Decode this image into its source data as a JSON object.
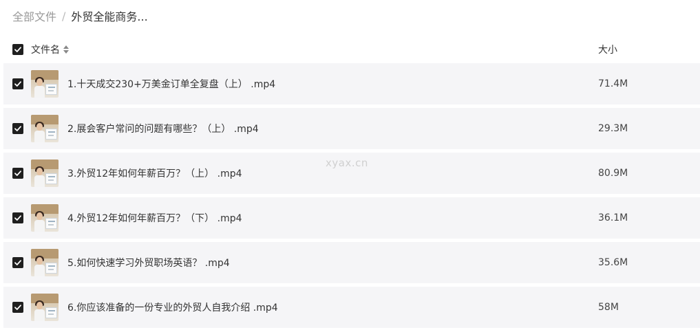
{
  "breadcrumb": {
    "root": "全部文件",
    "separator": "/",
    "current": "外贸全能商务..."
  },
  "header": {
    "name_label": "文件名",
    "size_label": "大小",
    "sort_icon": "sort-icon",
    "select_all_checked": true
  },
  "files": [
    {
      "name": "1.十天成交230+万美金订单全复盘（上） .mp4",
      "size": "71.4M",
      "checked": true
    },
    {
      "name": "2.展会客户常问的问题有哪些？（上） .mp4",
      "size": "29.3M",
      "checked": true
    },
    {
      "name": "3.外贸12年如何年薪百万？（上） .mp4",
      "size": "80.9M",
      "checked": true
    },
    {
      "name": "4.外贸12年如何年薪百万？（下） .mp4",
      "size": "36.1M",
      "checked": true
    },
    {
      "name": "5.如何快速学习外贸职场英语？ .mp4",
      "size": "35.6M",
      "checked": true
    },
    {
      "name": "6.你应该准备的一份专业的外贸人自我介绍 .mp4",
      "size": "58M",
      "checked": true
    }
  ],
  "watermark": "xyax.cn",
  "colors": {
    "row_background": "#f5f5f7",
    "checkbox_fill": "#1f1f1f",
    "breadcrumb_root": "#999999",
    "text": "#333333"
  }
}
